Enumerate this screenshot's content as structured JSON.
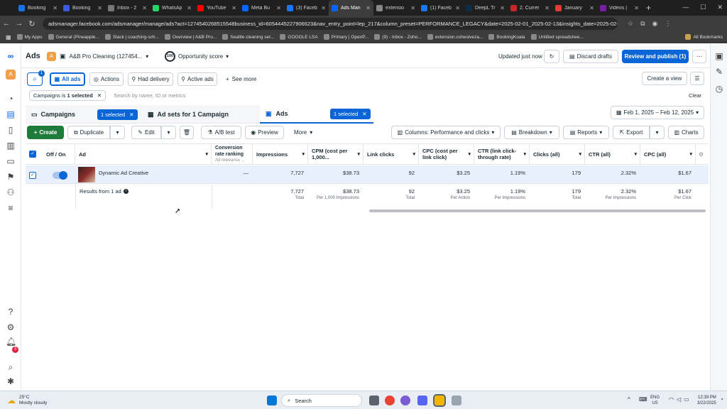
{
  "browser": {
    "tabs": [
      {
        "label": "Booking",
        "color": "#1a73e8"
      },
      {
        "label": "Booking",
        "color": "#3b5bdb"
      },
      {
        "label": "Inbox - 2",
        "color": "#777777"
      },
      {
        "label": "WhatsAp",
        "color": "#25d366"
      },
      {
        "label": "YouTube",
        "color": "#ff0000"
      },
      {
        "label": "Meta Bu",
        "color": "#0866ff"
      },
      {
        "label": "(3) Faceb",
        "color": "#1877f2"
      },
      {
        "label": "Ads Man",
        "color": "#0866ff"
      },
      {
        "label": "extensio",
        "color": "#888888"
      },
      {
        "label": "(1) Faceb",
        "color": "#1877f2"
      },
      {
        "label": "DeepL Tr",
        "color": "#0f2b46"
      },
      {
        "label": "2. Currer",
        "color": "#c62828"
      },
      {
        "label": "January",
        "color": "#e53935"
      },
      {
        "label": "Videos |",
        "color": "#7b1fa2"
      }
    ],
    "url": "adsmanager.facebook.com/adsmanager/manage/ads?act=1274540268515548business_id=6054445227906623&nav_entry_point=lep_217&column_preset=PERFORMANCE_LEGACY&date=2025-02-01_2025-02-13&insights_date=2025-02-01_...",
    "bookmarks": [
      "My Apps",
      "General (Pineapple...",
      "Slack | coaching-sch...",
      "Overview | A&B Pro...",
      "Seattle cleaning ser...",
      "GOOGLE LSA",
      "Primary | OpenP...",
      "(9) - Inbox - Zoho...",
      "extension.cohesiveza...",
      "BookingKoala",
      "Untitled spreadshee..."
    ],
    "all_bookmarks": "All Bookmarks"
  },
  "header": {
    "app_title": "Ads",
    "account_initial": "A",
    "account": "A&B Pro Cleaning (127454...",
    "opp_score": "100",
    "opp_label": "Opportunity score",
    "updated": "Updated just now",
    "discard": "Discard drafts",
    "review": "Review and publish (1)"
  },
  "filters": {
    "search_badge": "1",
    "all_ads": "All ads",
    "actions": "Actions",
    "had_delivery": "Had delivery",
    "active_ads": "Active ads",
    "see_more": "See more",
    "create_view": "Create a view",
    "chip": "Campaigns is",
    "chip_bold": "1 selected",
    "search_placeholder": "Search by name, ID or metrics",
    "clear": "Clear"
  },
  "levels": {
    "campaigns": "Campaigns",
    "campaigns_sel": "1 selected",
    "adsets": "Ad sets for 1 Campaign",
    "ads": "Ads",
    "ads_sel": "1 selected",
    "date_range": "Feb 1, 2025 – Feb 12, 2025"
  },
  "toolbar": {
    "create": "Create",
    "duplicate": "Duplicate",
    "edit": "Edit",
    "ab_test": "A/B test",
    "preview": "Preview",
    "more": "More",
    "columns": "Columns: Performance and clicks",
    "breakdown": "Breakdown",
    "reports": "Reports",
    "export": "Export",
    "charts": "Charts"
  },
  "table": {
    "headers": {
      "off_on": "Off / On",
      "ad": "Ad",
      "conv": "Conversion rate ranking",
      "conv_sub": "Ad relevance ...",
      "impressions": "Impressions",
      "cpm": "CPM (cost per 1,000...",
      "link_clicks": "Link clicks",
      "cpc_link": "CPC (cost per link click)",
      "ctr_link": "CTR (link click-through rate)",
      "clicks_all": "Clicks (all)",
      "ctr_all": "CTR (all)",
      "cpc_all": "CPC (all)"
    },
    "row": {
      "name": "Dynamic Ad Creative",
      "conv": "—",
      "impressions": "7,727",
      "cpm": "$38.73",
      "link_clicks": "92",
      "cpc_link": "$3.25",
      "ctr_link": "1.19%",
      "clicks_all": "179",
      "ctr_all": "2.32%",
      "cpc_all": "$1.67"
    },
    "totals": {
      "label": "Results from 1 ad",
      "impressions": "7,727",
      "impressions_sub": "Total",
      "cpm": "$38.73",
      "cpm_sub": "Per 1,000 Impressions",
      "link_clicks": "92",
      "link_clicks_sub": "Total",
      "cpc_link": "$3.25",
      "cpc_link_sub": "Per Action",
      "ctr_link": "1.19%",
      "ctr_link_sub": "Per Impressions",
      "clicks_all": "179",
      "clicks_all_sub": "Total",
      "ctr_all": "2.32%",
      "ctr_all_sub": "Per Impressions",
      "cpc_all": "$1.67",
      "cpc_all_sub": "Per Click"
    }
  },
  "left_badge": "3",
  "taskbar": {
    "temp": "25°C",
    "weather": "Mostly cloudy",
    "search": "Search",
    "lang1": "ENG",
    "lang2": "US",
    "time": "12:39 PM",
    "date": "3/22/2025"
  }
}
